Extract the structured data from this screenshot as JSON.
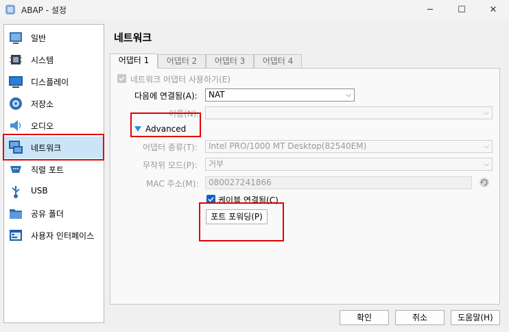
{
  "window": {
    "title": "ABAP - 설정"
  },
  "sidebar": {
    "items": [
      {
        "label": "일반",
        "icon": "general-icon"
      },
      {
        "label": "시스템",
        "icon": "system-chip-icon"
      },
      {
        "label": "디스플레이",
        "icon": "display-monitor-icon"
      },
      {
        "label": "저장소",
        "icon": "storage-disk-icon"
      },
      {
        "label": "오디오",
        "icon": "audio-speaker-icon"
      },
      {
        "label": "네트워크",
        "icon": "network-icon"
      },
      {
        "label": "직렬 포트",
        "icon": "serial-port-icon"
      },
      {
        "label": "USB",
        "icon": "usb-icon"
      },
      {
        "label": "공유 폴더",
        "icon": "shared-folder-icon"
      },
      {
        "label": "사용자 인터페이스",
        "icon": "user-interface-icon"
      }
    ],
    "selected": "네트워크"
  },
  "page": {
    "title": "네트워크"
  },
  "tabs": [
    "어댑터 1",
    "어댑터 2",
    "어댑터 3",
    "어댑터 4"
  ],
  "form": {
    "enable_label": "네트워크 어댑터 사용하기(E)",
    "attached_label": "다음에 연결됨(A):",
    "attached_value": "NAT",
    "name_label": "이름(N):",
    "name_value": "",
    "advanced_label": "Advanced",
    "adapter_type_label": "어댑터 종류(T):",
    "adapter_type_value": "Intel PRO/1000 MT Desktop(82540EM)",
    "promisc_label": "무작위 모드(P):",
    "promisc_value": "거부",
    "mac_label": "MAC 주소(M):",
    "mac_value": "080027241866",
    "cable_label": "케이블 연결됨(C)",
    "port_forward_label": "포트 포워딩(P)"
  },
  "footer": {
    "ok": "확인",
    "cancel": "취소",
    "help": "도움말(H)"
  },
  "colors": {
    "selection": "#cce4f7",
    "accent": "#0a64c8",
    "highlight": "#e00000"
  }
}
